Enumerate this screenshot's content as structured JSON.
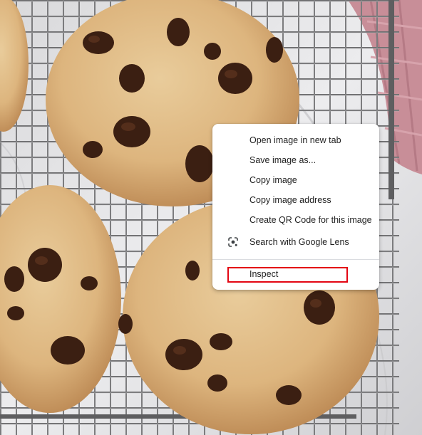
{
  "background": {
    "subject": "chocolate-chip-cookies-on-cooling-rack"
  },
  "context_menu": {
    "items": [
      {
        "label": "Open image in new tab"
      },
      {
        "label": "Save image as..."
      },
      {
        "label": "Copy image"
      },
      {
        "label": "Copy image address"
      },
      {
        "label": "Create QR Code for this image"
      },
      {
        "label": "Search with Google Lens",
        "icon": "google-lens-icon"
      },
      {
        "label": "Inspect",
        "highlighted": true
      }
    ]
  },
  "colors": {
    "menu_bg": "#ffffff",
    "highlight_border": "#e30613",
    "text": "#1f1f1f"
  }
}
